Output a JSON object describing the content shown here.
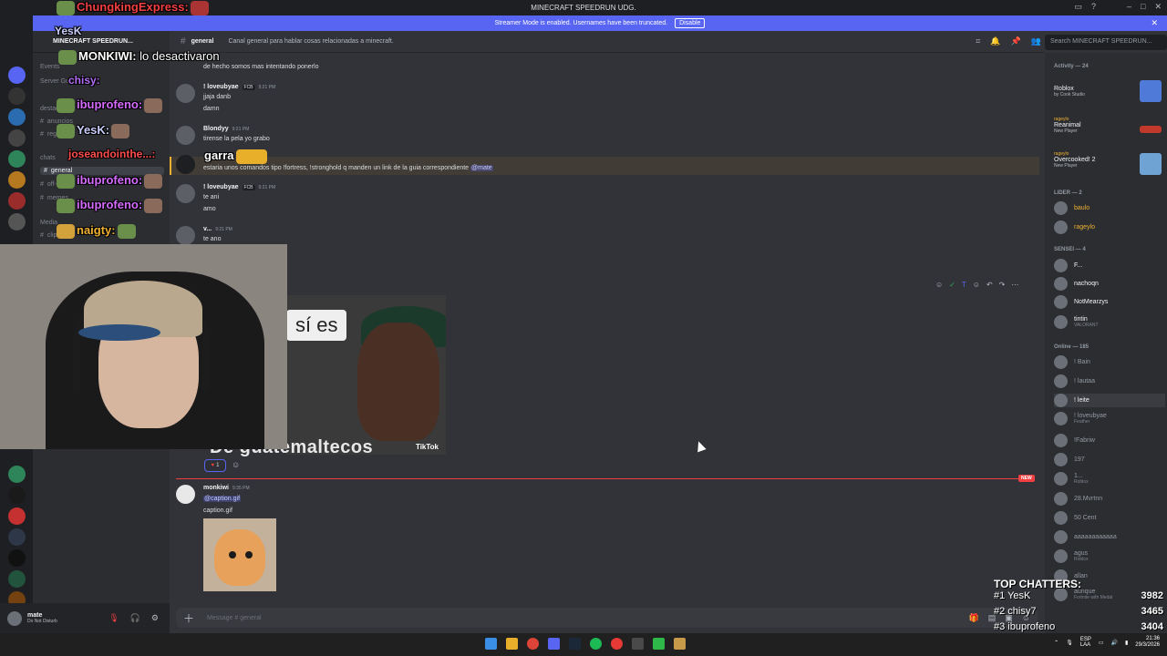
{
  "titlebar": {
    "title": "MINECRAFT SPEEDRUN UDG."
  },
  "banner": {
    "text": "Streamer Mode is enabled. Usernames have been truncated.",
    "disable": "Disable"
  },
  "server": {
    "name": "MINECRAFT SPEEDRUN...",
    "events": "Events",
    "server_guide": "Server Guide"
  },
  "sidebar": {
    "categories": [
      "destacado",
      "chats",
      "Media"
    ],
    "channels": [
      "anuncios",
      "reglas",
      "general",
      "off-topic",
      "memes",
      "clips"
    ],
    "active_channel": "general"
  },
  "user": {
    "name": "mate",
    "status": "Do Not Disturb"
  },
  "header": {
    "channel": "general",
    "topic": "Canal general para hablar cosas relacionadas a minecraft."
  },
  "search": {
    "placeholder": "Search MINECRAFT SPEEDRUN..."
  },
  "messages": [
    {
      "text": "de hecho somos mas intentando ponerlo"
    },
    {
      "author": "! loveubyae",
      "badge": "FCB",
      "time": "9:21 PM",
      "lines": [
        "jjaja danb",
        "damn"
      ]
    },
    {
      "author": "Blondyy",
      "time": "9:21 PM",
      "lines": [
        "tirense la pela yo grabo"
      ]
    },
    {
      "text": "estaria unos comandos tipo !fortress, !stronghold q manden un link de la guia correspondiente",
      "mention": "@mate"
    },
    {
      "author": "! loveubyae",
      "badge": "FCB",
      "time": "9:21 PM",
      "lines": [
        "te ani",
        "amo"
      ]
    },
    {
      "author": "v...",
      "time": "9:21 PM",
      "lines": [
        "te ano"
      ]
    }
  ],
  "meme": {
    "bubble": "sí es",
    "caption": "De guatemaltecos",
    "credit": "TikTok",
    "reaction_count": "1"
  },
  "new_label": "NEW",
  "caption_msg": {
    "author": "monkiwi",
    "time": "9:35 PM",
    "line1": "@caption.gif",
    "line2": "caption.gif"
  },
  "composer": {
    "placeholder": "Message #  general"
  },
  "activity": {
    "header": "Activity — 24",
    "items": [
      {
        "title": "Roblox",
        "sub": "by Cook Studio",
        "thumb": "#4f7ad8"
      },
      {
        "user": "rageylo",
        "title": "Reanimal",
        "sub": "New Player",
        "thumb": "#c0392b"
      },
      {
        "user": "rageylo",
        "title": "Overcooked! 2",
        "sub": "New Player",
        "thumb": "#6fa3d4"
      }
    ]
  },
  "member_sections": [
    {
      "label": "LIDER — 2",
      "members": [
        {
          "name": "baulo",
          "color": "#f0b132"
        },
        {
          "name": "rageylo",
          "color": "#f0b132"
        }
      ]
    },
    {
      "label": "SENSEI — 4",
      "members": [
        {
          "name": "F...",
          "color": "#f2f3f5"
        },
        {
          "name": "nachoqn",
          "color": "#f2f3f5"
        },
        {
          "name": "NotMearzys",
          "color": "#f2f3f5"
        },
        {
          "name": "tintin",
          "color": "#f2f3f5"
        }
      ]
    },
    {
      "label": "Online — 185",
      "members": [
        {
          "name": "! Bain",
          "color": "#949ba4"
        },
        {
          "name": "! lautaa",
          "color": "#949ba4"
        },
        {
          "name": "! leite",
          "color": "#f2f3f5"
        },
        {
          "name": "! loveubyae",
          "color": "#949ba4"
        },
        {
          "name": "!Fabriw",
          "color": "#949ba4"
        },
        {
          "name": "197",
          "color": "#949ba4"
        },
        {
          "name": "1...",
          "color": "#949ba4"
        },
        {
          "name": "28.Mvrtnn",
          "color": "#949ba4"
        },
        {
          "name": "50 Cent",
          "color": "#949ba4"
        },
        {
          "name": "aaaaaaaaaaaa",
          "color": "#949ba4"
        },
        {
          "name": "agus",
          "color": "#949ba4"
        },
        {
          "name": "allan",
          "color": "#949ba4"
        },
        {
          "name": "aunque",
          "color": "#949ba4"
        }
      ]
    }
  ],
  "member_subs": {
    "nachoqn": "",
    "NotMearzys": "",
    "tintin": "VALORANT",
    "! loveubyae": "Feather",
    "1...": "Roblox",
    "agus": "Roblox",
    "aunque": "Fortnite with Medal"
  },
  "overlay": [
    {
      "name": "ChungkingExpress:",
      "color": "#f23f42",
      "text": ""
    },
    {
      "name": "YesK",
      "color": "#c9cdfb",
      "text": ""
    },
    {
      "name": "MONKIWI:",
      "color": "#ffffff",
      "text": "lo desactivaron"
    },
    {
      "name": "chisy:",
      "color": "#b36ef5",
      "text": ""
    },
    {
      "name": "ibuprofeno:",
      "color": "#d66bff",
      "text": ""
    },
    {
      "name": "YesK:",
      "color": "#c9cdfb",
      "text": ""
    },
    {
      "name": "joseandointhe...:",
      "color": "#ff4d4d",
      "text": ""
    },
    {
      "name": "ibuprofeno:",
      "color": "#d66bff",
      "text": ""
    },
    {
      "name": "ibuprofeno:",
      "color": "#d66bff",
      "text": ""
    },
    {
      "name": "naigty:",
      "color": "#f0b132",
      "text": ""
    },
    {
      "name": "",
      "color": "#ffffff",
      "text": "garra"
    }
  ],
  "top_chatters": {
    "title": "TOP CHATTERS:",
    "rows": [
      {
        "name": "#1 YesK",
        "value": "3982"
      },
      {
        "name": "#2 chisy7",
        "value": "3465"
      },
      {
        "name": "#3 ibuprofeno",
        "value": "3404"
      }
    ]
  },
  "clock": {
    "time": "21:36",
    "date": "29/3/2026",
    "lang": "ESP",
    "region": "LAA"
  }
}
